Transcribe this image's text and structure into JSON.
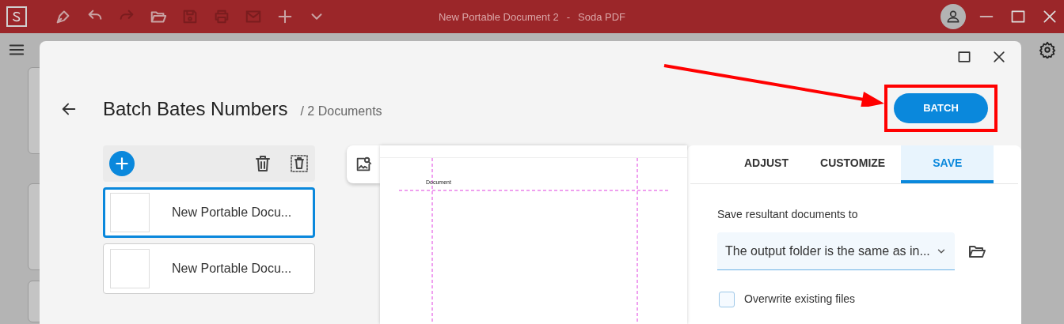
{
  "window": {
    "document_title": "New Portable Document 2",
    "separator": "-",
    "app_name": "Soda PDF"
  },
  "dialog": {
    "title": "Batch Bates Numbers",
    "subtitle": "/ 2 Documents",
    "batch_button": "BATCH",
    "documents": [
      {
        "name": "New Portable Docu...",
        "selected": true
      },
      {
        "name": "New Portable Docu...",
        "selected": false
      }
    ],
    "preview": {
      "header_text": "Document"
    },
    "tabs": [
      {
        "label": "ADJUST",
        "selected": false
      },
      {
        "label": "CUSTOMIZE",
        "selected": false
      },
      {
        "label": "SAVE",
        "selected": true
      }
    ],
    "save_label": "Save resultant documents to",
    "output_folder": "The output folder is the same as in...",
    "overwrite": {
      "label": "Overwrite existing files",
      "checked": false
    }
  }
}
